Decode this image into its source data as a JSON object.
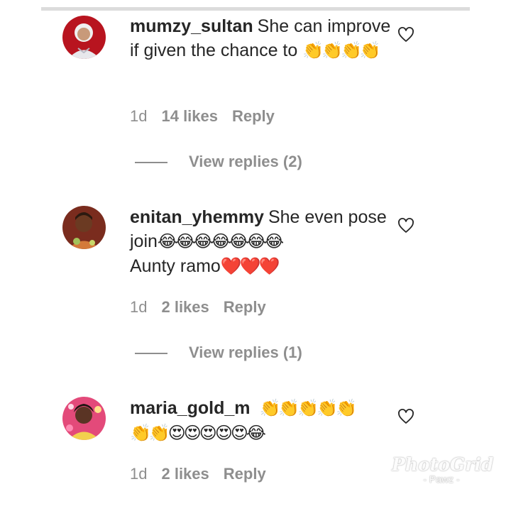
{
  "comments": [
    {
      "username": "mumzy_sultan",
      "text": "She can improve if given the chance to",
      "emoji": "👏👏👏👏",
      "time": "1d",
      "likes": "14 likes",
      "reply": "Reply",
      "view_replies": "View replies (2)"
    },
    {
      "username": "enitan_yhemmy",
      "text": "She even pose join",
      "emoji": "😂😂😂😂😂😂😂",
      "text2": "Aunty ramo",
      "emoji2": "❤️❤️❤️",
      "time": "1d",
      "likes": "2 likes",
      "reply": "Reply",
      "view_replies": "View replies (1)"
    },
    {
      "username": "maria_gold_m",
      "emoji": "👏👏👏👏👏",
      "emoji2": "👏👏😍😍😍😍😍😂",
      "time": "1d",
      "likes": "2 likes",
      "reply": "Reply"
    }
  ],
  "watermark": {
    "main": "PhotoGrid",
    "sub": "- Pawz -"
  },
  "icons": {
    "like": "heart-outline-icon"
  }
}
